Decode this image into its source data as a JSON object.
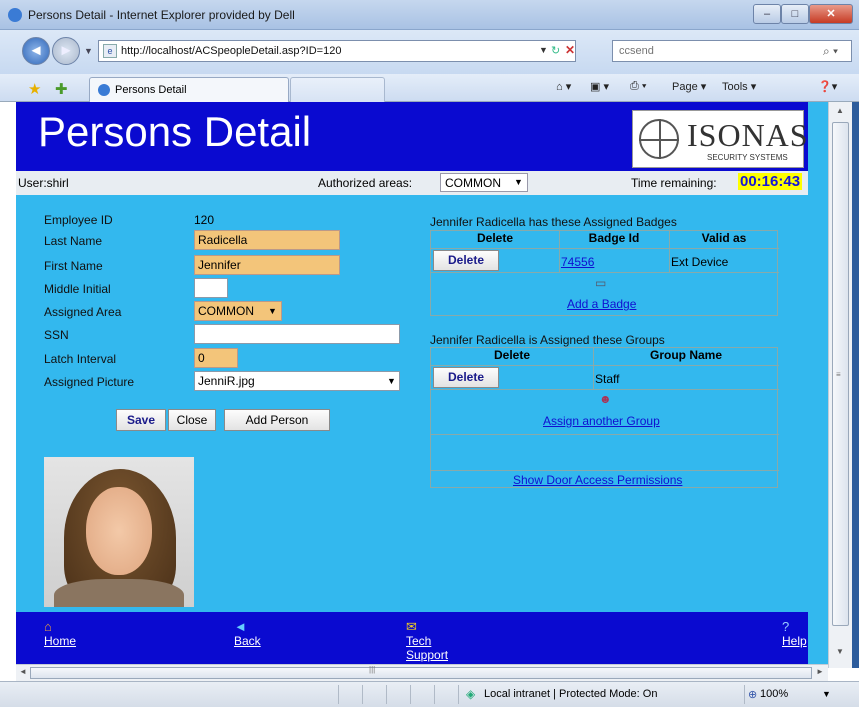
{
  "window": {
    "title": "Persons Detail - Internet Explorer provided by Dell",
    "min_label": "–",
    "max_label": "□",
    "close_label": "✕"
  },
  "browser": {
    "url": "http://localhost/ACSpeopleDetail.asp?ID=120",
    "search_placeholder": "ccsend",
    "tab_label": "Persons Detail",
    "page_menu": "Page ▾",
    "tools_menu": "Tools ▾",
    "zone_text": "Local intranet | Protected Mode: On",
    "zoom": "100%"
  },
  "header": {
    "title": "Persons Detail",
    "logo_text": "ISONAS",
    "logo_tagline": "SECURITY SYSTEMS"
  },
  "infobar": {
    "user": "User:shirl",
    "areas_label": "Authorized areas:",
    "areas_value": "COMMON",
    "time_label": "Time remaining:",
    "time_value": "00:16:43"
  },
  "form": {
    "employee_id_label": "Employee ID",
    "employee_id": "120",
    "last_name_label": "Last Name",
    "last_name": "Radicella",
    "first_name_label": "First Name",
    "first_name": "Jennifer",
    "middle_initial_label": "Middle Initial",
    "middle_initial": "",
    "assigned_area_label": "Assigned Area",
    "assigned_area": "COMMON",
    "ssn_label": "SSN",
    "ssn": "",
    "latch_interval_label": "Latch Interval",
    "latch_interval": "0",
    "assigned_picture_label": "Assigned Picture",
    "assigned_picture": "JenniR.jpg",
    "save_label": "Save",
    "close_label": "Close",
    "add_person_label": "Add Person"
  },
  "badges": {
    "title": "Jennifer Radicella has these Assigned Badges",
    "headers": [
      "Delete",
      "Badge Id",
      "Valid as"
    ],
    "rows": [
      {
        "delete": "Delete",
        "badge_id": "74556",
        "valid_as": "Ext Device"
      }
    ],
    "add_label": "Add a Badge"
  },
  "groups": {
    "title": "Jennifer Radicella is Assigned these Groups",
    "headers": [
      "Delete",
      "Group Name"
    ],
    "rows": [
      {
        "delete": "Delete",
        "group_name": "Staff"
      }
    ],
    "assign_label": "Assign another Group",
    "door_access_label": "Show Door Access Permissions"
  },
  "footer": {
    "home": "Home",
    "back": "Back",
    "tech_support": "Tech Support",
    "help": "Help"
  }
}
